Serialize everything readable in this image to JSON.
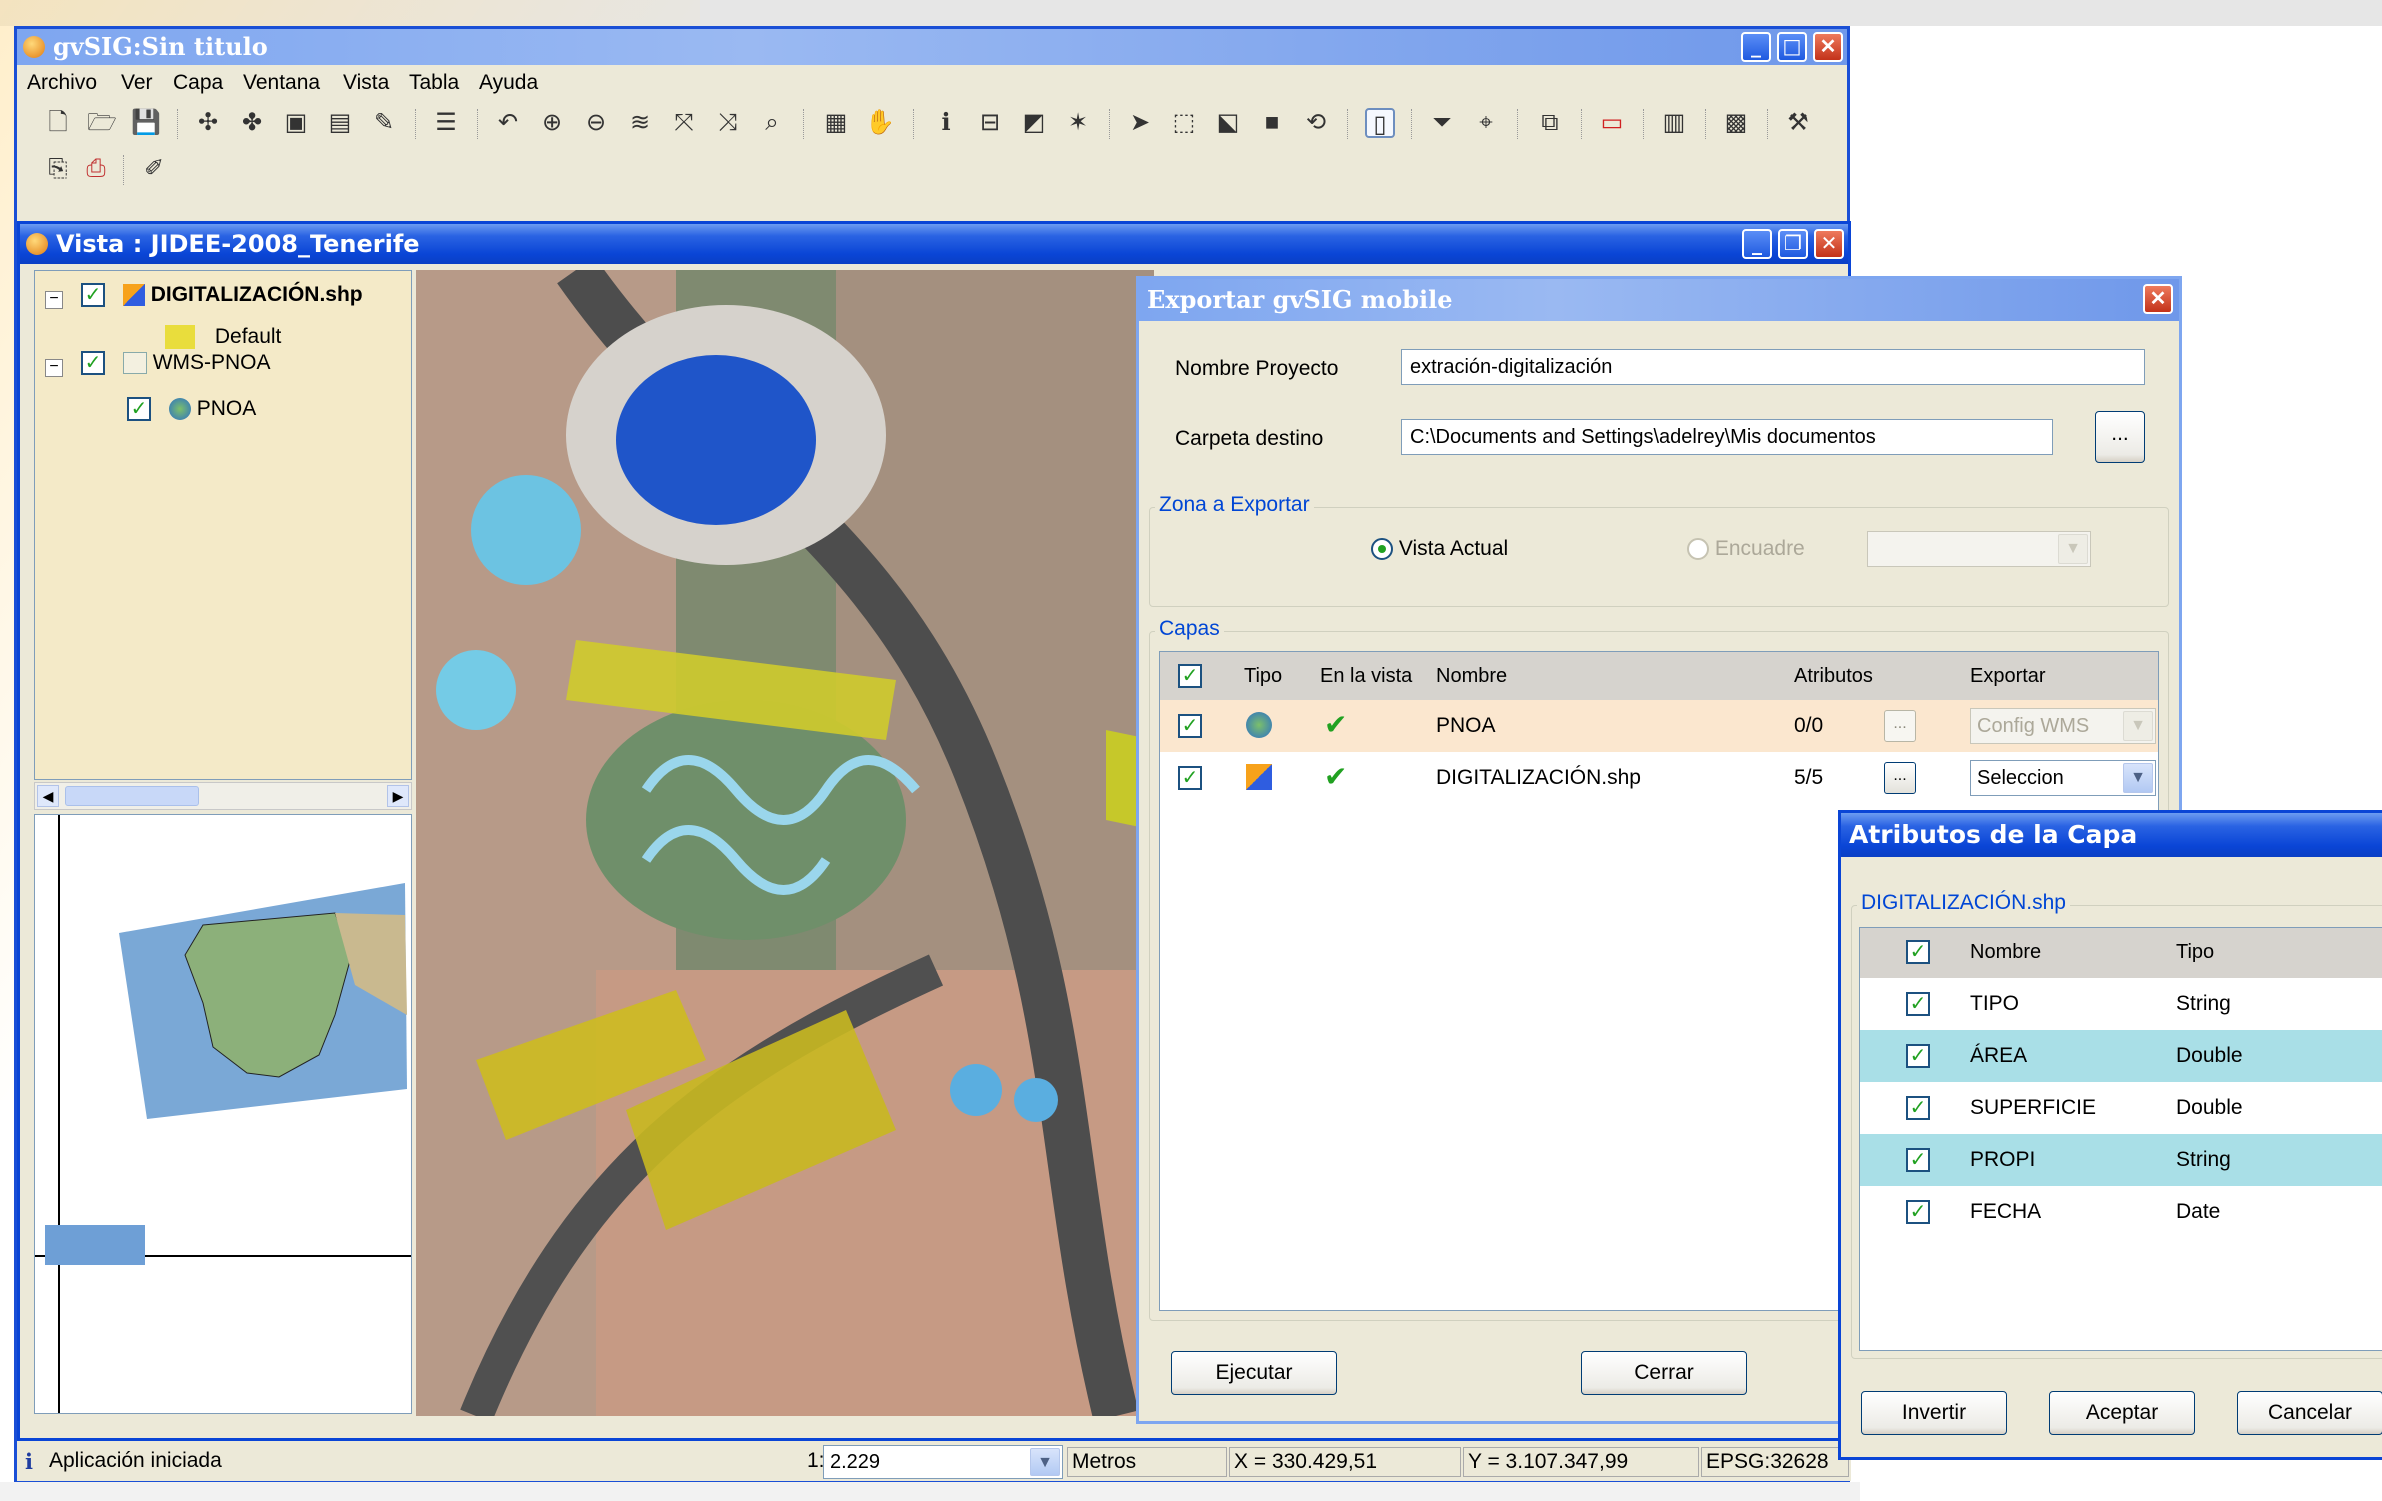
{
  "app": {
    "title": "gvSIG:Sin titulo",
    "menu": [
      "Archivo",
      "Ver",
      "Capa",
      "Ventana",
      "Vista",
      "Tabla",
      "Ayuda"
    ]
  },
  "view": {
    "title": "Vista : JIDEE-2008_Tenerife",
    "toc": {
      "layers": [
        {
          "label": "DIGITALIZACIÓN.shp",
          "checked": true
        },
        {
          "label": "Default"
        },
        {
          "label": "WMS-PNOA",
          "checked": true
        },
        {
          "label": "PNOA",
          "checked": true
        }
      ]
    }
  },
  "status": {
    "message": "Aplicación iniciada",
    "scale_prefix": "1:",
    "scale_value": "2.229",
    "units": "Metros",
    "x": "X = 330.429,51",
    "y": "Y = 3.107.347,99",
    "epsg": "EPSG:32628"
  },
  "export_dialog": {
    "title": "Exportar gvSIG mobile",
    "project_label": "Nombre Proyecto",
    "project_value": "extración-digitalización",
    "folder_label": "Carpeta destino",
    "folder_value": "C:\\Documents and Settings\\adelrey\\Mis documentos",
    "browse_label": "...",
    "zone_group": "Zona a Exportar",
    "zone_current": "Vista Actual",
    "zone_frame": "Encuadre",
    "layers_group": "Capas",
    "columns": [
      "Tipo",
      "En la vista",
      "Nombre",
      "Atributos",
      "Exportar"
    ],
    "rows": [
      {
        "name": "PNOA",
        "attributes": "0/0",
        "export": "Config WMS"
      },
      {
        "name": "DIGITALIZACIÓN.shp",
        "attributes": "5/5",
        "export": "Seleccion"
      }
    ],
    "run_label": "Ejecutar",
    "close_label": "Cerrar"
  },
  "attr_dialog": {
    "title": "Atributos de la Capa",
    "group": "DIGITALIZACIÓN.shp",
    "columns": [
      "Nombre",
      "Tipo"
    ],
    "rows": [
      {
        "name": "TIPO",
        "type": "String"
      },
      {
        "name": "ÁREA",
        "type": "Double"
      },
      {
        "name": "SUPERFICIE",
        "type": "Double"
      },
      {
        "name": "PROPI",
        "type": "String"
      },
      {
        "name": "FECHA",
        "type": "Date"
      }
    ],
    "invert_label": "Invertir",
    "accept_label": "Aceptar",
    "cancel_label": "Cancelar"
  },
  "colors": {
    "xp_blue": "#0a45d6",
    "row_highlight": "#fbe7cf",
    "attr_highlight": "#a9dfe7",
    "group_title": "#0046d5"
  }
}
